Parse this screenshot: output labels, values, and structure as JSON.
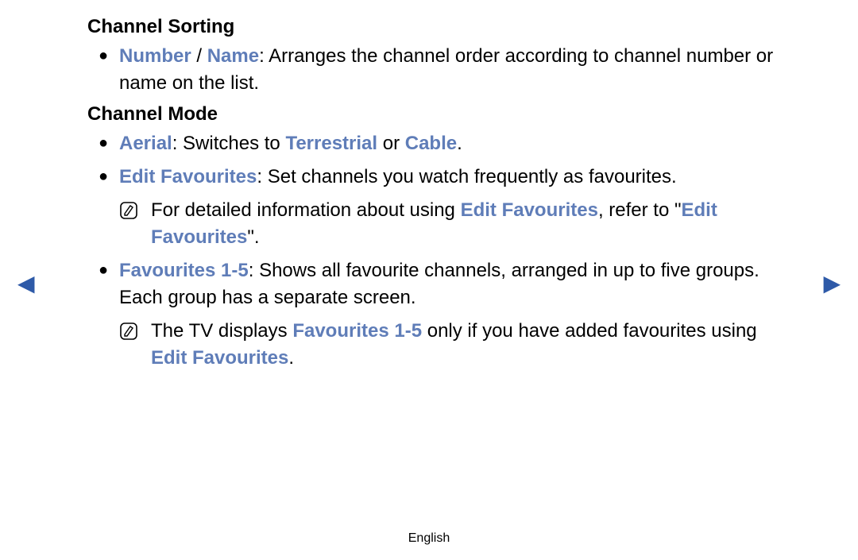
{
  "nav": {
    "prev_glyph": "◀",
    "next_glyph": "▶"
  },
  "footer": {
    "language": "English"
  },
  "sections": {
    "sorting": {
      "heading": "Channel Sorting",
      "item1": {
        "term1": "Number",
        "slash": " / ",
        "term2": "Name",
        "desc": ": Arranges the channel order according to channel number or name on the list."
      }
    },
    "mode": {
      "heading": "Channel Mode",
      "aerial": {
        "term": "Aerial",
        "t1": ": Switches to ",
        "opt1": "Terrestrial",
        "t2": " or ",
        "opt2": "Cable",
        "t3": "."
      },
      "editfav": {
        "term": "Edit Favourites",
        "desc": ": Set channels you watch frequently as favourites."
      },
      "editfav_note": {
        "t1": "For detailed information about using ",
        "b1": "Edit Favourites",
        "t2": ", refer to \"",
        "b2": "Edit Favourites",
        "t3": "\"."
      },
      "fav15": {
        "term": "Favourites 1-5",
        "desc": ": Shows all favourite channels, arranged in up to five groups. Each group has a separate screen."
      },
      "fav15_note": {
        "t1": "The TV displays ",
        "b1": "Favourites 1-5",
        "t2": " only if you have added favourites using ",
        "b2": "Edit Favourites",
        "t3": "."
      }
    }
  },
  "glyphs": {
    "bullet": "●"
  }
}
